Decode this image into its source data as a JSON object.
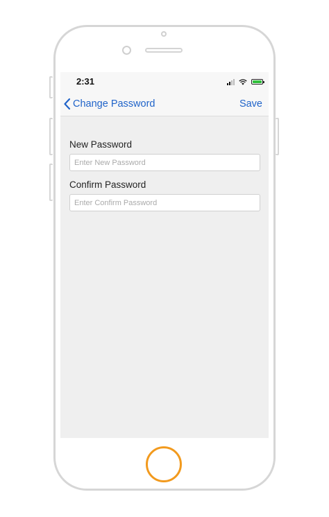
{
  "status_bar": {
    "time": "2:31"
  },
  "nav": {
    "back_label": "Change Password",
    "save_label": "Save"
  },
  "form": {
    "new_password": {
      "label": "New Password",
      "placeholder": "Enter New Password",
      "value": ""
    },
    "confirm_password": {
      "label": "Confirm Password",
      "placeholder": "Enter Confirm Password",
      "value": ""
    }
  },
  "colors": {
    "accent": "#1f63c9",
    "home_button": "#f29a1e",
    "battery": "#2fbf3a"
  },
  "icons": {
    "back": "chevron-left-icon",
    "signal": "cellular-signal-icon",
    "wifi": "wifi-icon",
    "battery": "battery-charging-icon"
  }
}
